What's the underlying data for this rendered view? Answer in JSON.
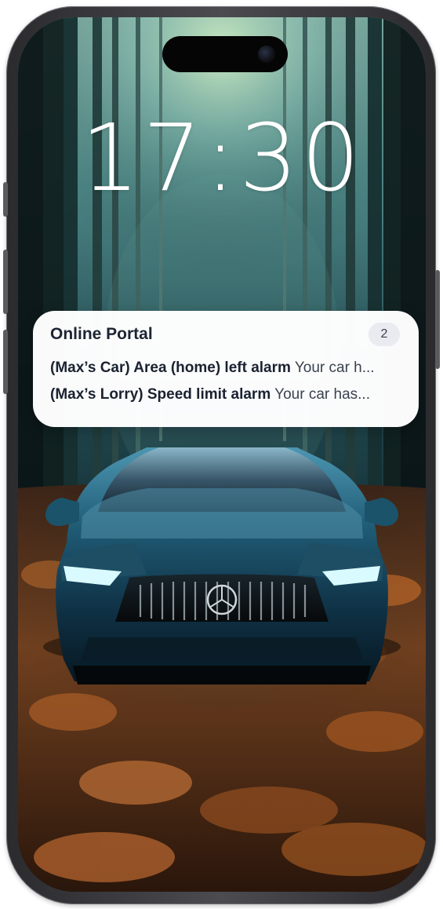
{
  "lockscreen": {
    "time": "17:30"
  },
  "notification": {
    "app_name": "Online Portal",
    "count": "2",
    "items": [
      {
        "title": "(Max’s Car) Area (home) left alarm",
        "body": "Your car h..."
      },
      {
        "title": "(Max’s Lorry) Speed limit alarm",
        "body": "Your car has..."
      }
    ]
  },
  "colors": {
    "notification_bg": "#ffffff",
    "notification_text": "#1d2533",
    "count_badge_bg": "#e9ebf0",
    "phone_frame": "#3a3a3f"
  },
  "wallpaper": {
    "semantic": "blue-car-in-autumn-forest"
  }
}
